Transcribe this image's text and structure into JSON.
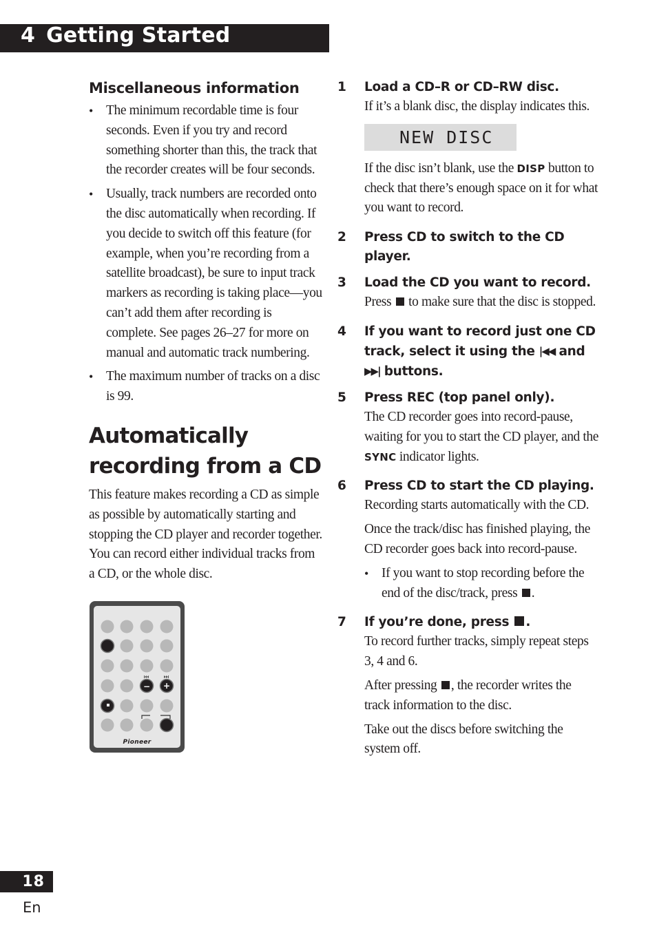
{
  "header": {
    "chapter_number": "4",
    "chapter_title": "Getting Started"
  },
  "left": {
    "misc_heading": "Miscellaneous information",
    "misc_bullets": [
      "The minimum recordable time is four seconds. Even if you try and record something shorter than this, the track that the recorder creates will be four seconds.",
      "Usually, track numbers are recorded onto the disc automatically when recording. If you decide to switch off this feature (for example, when you’re recording from a satellite broadcast), be sure to input track markers as recording is taking place—you can’t add them after recording is complete. See pages 26–27 for more on manual and automatic track numbering.",
      "The maximum number of tracks on a disc is 99."
    ],
    "section_heading": "Automatically recording from a CD",
    "intro": "This feature makes recording a CD as simple as possible by automatically starting and stopping the CD player and recorder together. You can record either individual tracks from a CD, or the whole disc.",
    "remote": {
      "brand": "Pioneer",
      "prev_label": "⏮",
      "next_label": "⏭",
      "minus_label": "−",
      "plus_label": "+",
      "colors": {
        "body": "#4a4a4a",
        "face": "#e6e6e6",
        "button_gray": "#b8b8b8",
        "button_dark": "#231f20"
      }
    }
  },
  "steps": [
    {
      "num": "1",
      "title": "Load a CD–R or CD–RW disc.",
      "text1": "If it’s a blank disc, the display indicates this.",
      "display": "NEW DISC",
      "text2_pre": "If the disc isn’t blank, use the ",
      "text2_kw": "DISP",
      "text2_post": " button to check that there’s enough space on it for what you want to record."
    },
    {
      "num": "2",
      "title": "Press CD to switch to the CD player."
    },
    {
      "num": "3",
      "title": "Load the CD you want to record.",
      "text_pre": "Press ",
      "text_post": " to make sure that the disc is stopped."
    },
    {
      "num": "4",
      "title_pre": "If you want to record just one CD track, select it using the ",
      "prev_symbol": "|◀◀",
      "title_mid": " and ",
      "next_symbol": "▶▶|",
      "title_post": " buttons."
    },
    {
      "num": "5",
      "title": "Press REC (top panel only).",
      "text_pre": "The CD recorder goes into record-pause, waiting for you to start the CD player, and the ",
      "text_kw": "SYNC",
      "text_post": " indicator lights."
    },
    {
      "num": "6",
      "title": "Press CD to start the CD playing.",
      "text1": "Recording starts automatically with the CD.",
      "text2": "Once the track/disc has finished playing, the CD recorder goes back into record-pause.",
      "bullet_pre": "If you want to stop recording before the end of the disc/track, press ",
      "bullet_post": "."
    },
    {
      "num": "7",
      "title_pre": "If you’re done, press ",
      "title_post": ".",
      "text1": "To record further tracks, simply repeat steps 3, 4 and 6.",
      "text2_pre": "After pressing ",
      "text2_post": ", the recorder writes the track information to the disc.",
      "text3": "Take out the discs before switching the system off."
    }
  ],
  "footer": {
    "page_number": "18",
    "language": "En"
  }
}
